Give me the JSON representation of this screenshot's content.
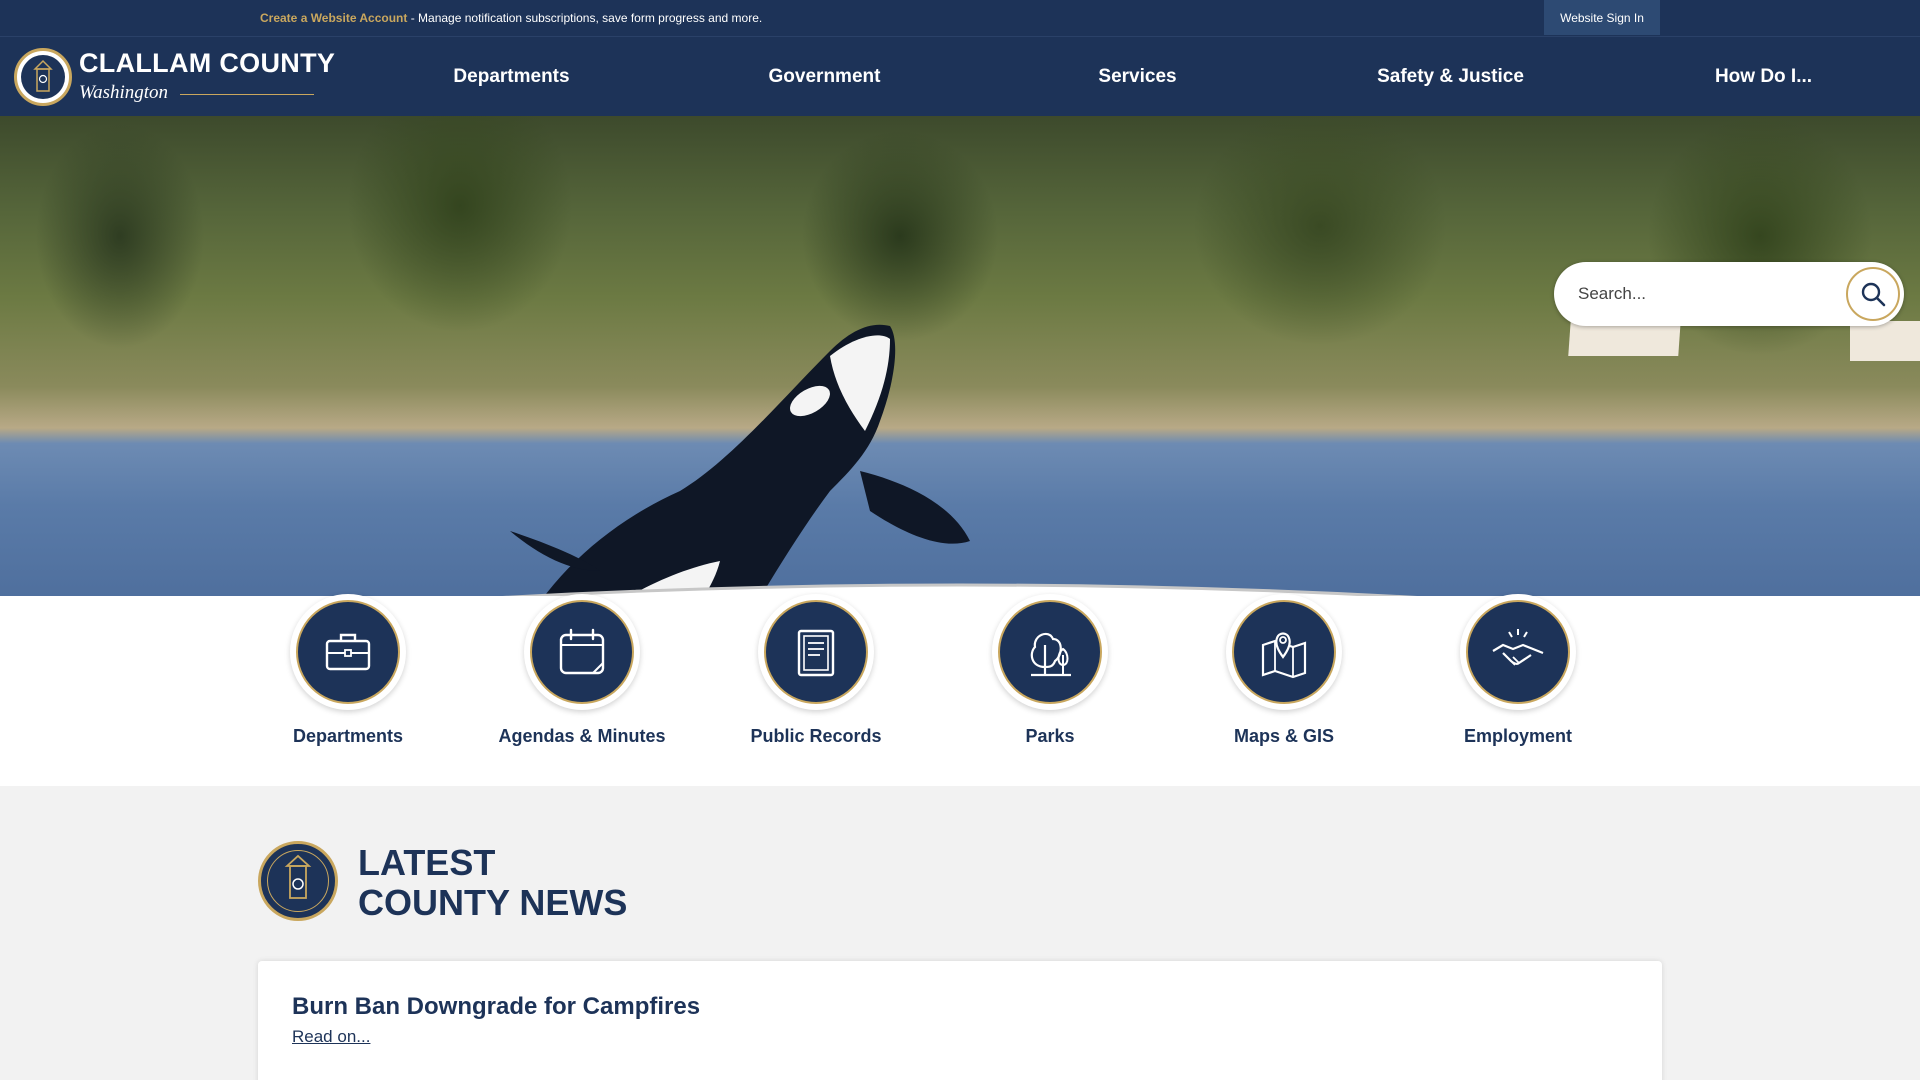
{
  "topbar": {
    "create_account_link": "Create a Website Account",
    "notice_text": " - Manage notification subscriptions, save form progress and more.",
    "sign_in_label": "Website Sign In"
  },
  "logo": {
    "name": "CLALLAM COUNTY",
    "sub": "Washington"
  },
  "nav": {
    "items": [
      "Departments",
      "Government",
      "Services",
      "Safety & Justice",
      "How Do I..."
    ]
  },
  "search": {
    "placeholder": "Search..."
  },
  "quick_links": [
    {
      "label": "Departments",
      "icon": "briefcase-icon"
    },
    {
      "label": "Agendas & Minutes",
      "icon": "calendar-icon"
    },
    {
      "label": "Public Records",
      "icon": "document-icon"
    },
    {
      "label": "Parks",
      "icon": "trees-icon"
    },
    {
      "label": "Maps & GIS",
      "icon": "map-pin-icon"
    },
    {
      "label": "Employment",
      "icon": "handshake-icon"
    }
  ],
  "news": {
    "title_line1": "LATEST",
    "title_line2": "COUNTY NEWS",
    "items": [
      {
        "headline": "Burn Ban Downgrade for Campfires",
        "link": "Read on..."
      }
    ]
  },
  "colors": {
    "navy": "#1d3358",
    "gold": "#c9a75e",
    "background": "#f2f2f2"
  }
}
